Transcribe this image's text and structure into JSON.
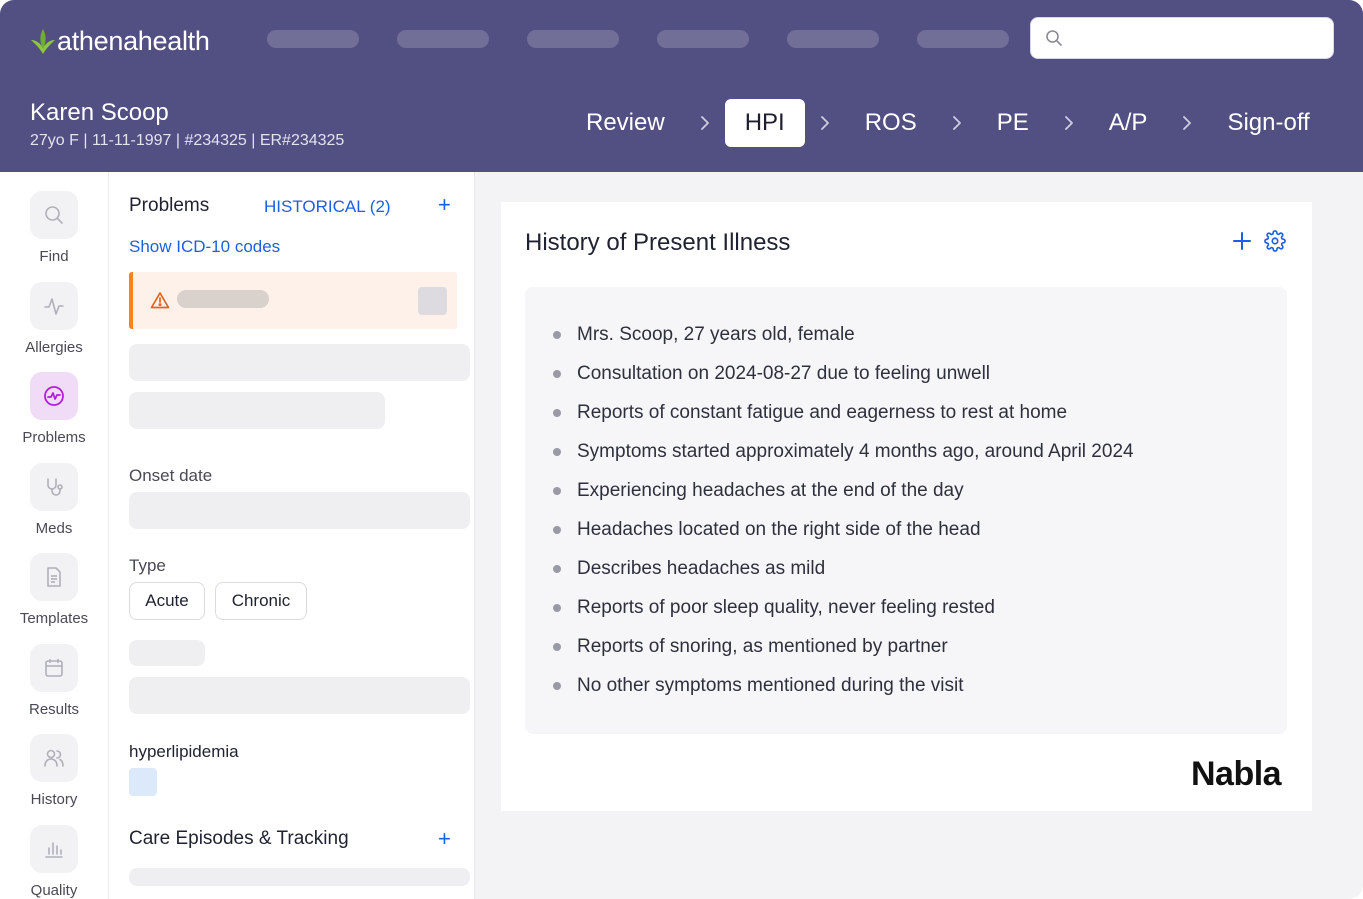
{
  "brand": {
    "logo_prefix": "athena",
    "logo_suffix": "health",
    "accent": "#1d5fe0",
    "header_bg": "#524f82",
    "leaf_color": "#8fc640"
  },
  "search": {
    "placeholder": ""
  },
  "patient": {
    "name": "Karen Scoop",
    "meta": "27yo F | 11-11-1997 | #234325 | ER#234325"
  },
  "steps": [
    {
      "label": "Review"
    },
    {
      "label": "HPI",
      "active": true
    },
    {
      "label": "ROS"
    },
    {
      "label": "PE"
    },
    {
      "label": "A/P"
    },
    {
      "label": "Sign-off"
    }
  ],
  "sidebar": {
    "items": [
      {
        "label": "Find",
        "icon": "search-icon"
      },
      {
        "label": "Allergies",
        "icon": "pulse-icon"
      },
      {
        "label": "Problems",
        "icon": "problems-icon",
        "active": true
      },
      {
        "label": "Meds",
        "icon": "stethoscope-icon"
      },
      {
        "label": "Templates",
        "icon": "document-icon"
      },
      {
        "label": "Results",
        "icon": "calendar-icon"
      },
      {
        "label": "History",
        "icon": "users-icon"
      },
      {
        "label": "Quality",
        "icon": "bar-chart-icon"
      }
    ]
  },
  "problems": {
    "title": "Problems",
    "historical": "HISTORICAL (2)",
    "add": "+",
    "icd_link": "Show ICD-10 codes",
    "onset_label": "Onset date",
    "type_label": "Type",
    "types": [
      "Acute",
      "Chronic"
    ],
    "problem_name": "hyperlipidemia",
    "care_title": "Care Episodes & Tracking",
    "care_add": "+"
  },
  "hpi": {
    "title": "History of Present Illness",
    "items": [
      "Mrs. Scoop, 27 years old, female",
      "Consultation on 2024-08-27 due to feeling unwell",
      "Reports of constant fatigue and eagerness to rest at home",
      "Symptoms started approximately 4 months ago, around April 2024",
      "Experiencing headaches at the end of the day",
      "Headaches located on the right side of the head",
      "Describes headaches as mild",
      "Reports of poor sleep quality, never feeling rested",
      "Reports of snoring, as mentioned by partner",
      "No other symptoms mentioned during the visit"
    ],
    "footer_logo": "Nabla"
  }
}
